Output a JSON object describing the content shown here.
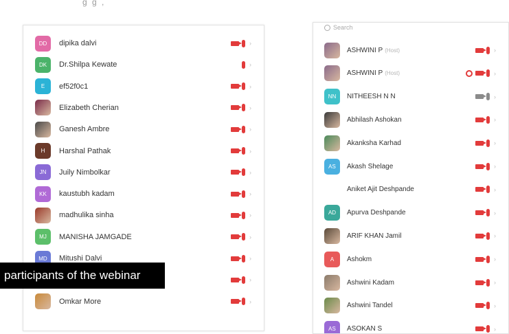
{
  "left_panel": {
    "participants": [
      {
        "name": "dipika dalvi",
        "initials": "DD",
        "color": "#e26aa6",
        "photo": false,
        "cam": true,
        "mic": true
      },
      {
        "name": "Dr.Shilpa Kewate",
        "initials": "DK",
        "color": "#4bb36a",
        "photo": false,
        "cam": false,
        "mic": true
      },
      {
        "name": "ef52f0c1",
        "initials": "E",
        "color": "#2bb3d6",
        "photo": false,
        "cam": true,
        "mic": true
      },
      {
        "name": "Elizabeth Cherian",
        "initials": "",
        "color": "#7a2c4a",
        "photo": true,
        "cam": true,
        "mic": true
      },
      {
        "name": "Ganesh Ambre",
        "initials": "",
        "color": "#4a4a4a",
        "photo": true,
        "cam": true,
        "mic": true
      },
      {
        "name": "Harshal Pathak",
        "initials": "H",
        "color": "#6b3a2a",
        "photo": false,
        "cam": true,
        "mic": true
      },
      {
        "name": "Juily Nimbolkar",
        "initials": "JN",
        "color": "#8a6ad6",
        "photo": false,
        "cam": true,
        "mic": true
      },
      {
        "name": "kaustubh kadam",
        "initials": "KK",
        "color": "#b06ad6",
        "photo": false,
        "cam": true,
        "mic": true
      },
      {
        "name": "madhulika sinha",
        "initials": "",
        "color": "#9a3a2a",
        "photo": true,
        "cam": true,
        "mic": true
      },
      {
        "name": "MANISHA JAMGADE",
        "initials": "MJ",
        "color": "#5cbf6a",
        "photo": false,
        "cam": true,
        "mic": true
      },
      {
        "name": "Mitushi Dalvi",
        "initials": "MD",
        "color": "#6a7ad6",
        "photo": false,
        "cam": true,
        "mic": true
      },
      {
        "name": "",
        "initials": "",
        "color": "#cfcfcf",
        "photo": false,
        "cam": true,
        "mic": true
      },
      {
        "name": "Omkar More",
        "initials": "",
        "color": "#c98a3a",
        "photo": true,
        "cam": true,
        "mic": true
      }
    ]
  },
  "right_panel": {
    "search_placeholder": "Search",
    "participants": [
      {
        "name": "ASHWINI P",
        "role": "(Host)",
        "initials": "",
        "color": "#8a6a8a",
        "photo": true,
        "record": false,
        "cam": true,
        "mic": true,
        "cam_grey": false
      },
      {
        "name": "ASHWINI P",
        "role": "(Host)",
        "initials": "",
        "color": "#8a6a8a",
        "photo": true,
        "record": true,
        "cam": true,
        "mic": true,
        "cam_grey": false
      },
      {
        "name": "NITHEESH N N",
        "role": "",
        "initials": "NN",
        "color": "#3fc1c9",
        "photo": false,
        "record": false,
        "cam": true,
        "mic": true,
        "cam_grey": true
      },
      {
        "name": "Abhilash Ashokan",
        "role": "",
        "initials": "",
        "color": "#3a3a3a",
        "photo": true,
        "record": false,
        "cam": true,
        "mic": true,
        "cam_grey": false
      },
      {
        "name": "Akanksha Karhad",
        "role": "",
        "initials": "",
        "color": "#4a8a5a",
        "photo": true,
        "record": false,
        "cam": true,
        "mic": true,
        "cam_grey": false
      },
      {
        "name": "Akash Shelage",
        "role": "",
        "initials": "AS",
        "color": "#4ab0e0",
        "photo": false,
        "record": false,
        "cam": true,
        "mic": true,
        "cam_grey": false
      },
      {
        "name": "Aniket Ajit Deshpande",
        "role": "",
        "initials": "",
        "color": "transparent",
        "photo": false,
        "record": false,
        "cam": true,
        "mic": true,
        "cam_grey": false
      },
      {
        "name": "Apurva Deshpande",
        "role": "",
        "initials": "AD",
        "color": "#3aa89a",
        "photo": false,
        "record": false,
        "cam": true,
        "mic": true,
        "cam_grey": false
      },
      {
        "name": "ARIF KHAN Jamil",
        "role": "",
        "initials": "",
        "color": "#5a4a3a",
        "photo": true,
        "record": false,
        "cam": true,
        "mic": true,
        "cam_grey": false
      },
      {
        "name": "Ashokm",
        "role": "",
        "initials": "A",
        "color": "#e85a5a",
        "photo": false,
        "record": false,
        "cam": true,
        "mic": true,
        "cam_grey": false
      },
      {
        "name": "Ashwini Kadam",
        "role": "",
        "initials": "",
        "color": "#8a7a6a",
        "photo": true,
        "record": false,
        "cam": true,
        "mic": true,
        "cam_grey": false
      },
      {
        "name": "Ashwini Tandel",
        "role": "",
        "initials": "",
        "color": "#6a8a4a",
        "photo": true,
        "record": false,
        "cam": true,
        "mic": true,
        "cam_grey": false
      },
      {
        "name": "ASOKAN S",
        "role": "",
        "initials": "AS",
        "color": "#9a6ad6",
        "photo": false,
        "record": false,
        "cam": true,
        "mic": true,
        "cam_grey": false
      }
    ]
  },
  "caption": "participants of the webinar",
  "top_clip_text": "g g ,"
}
